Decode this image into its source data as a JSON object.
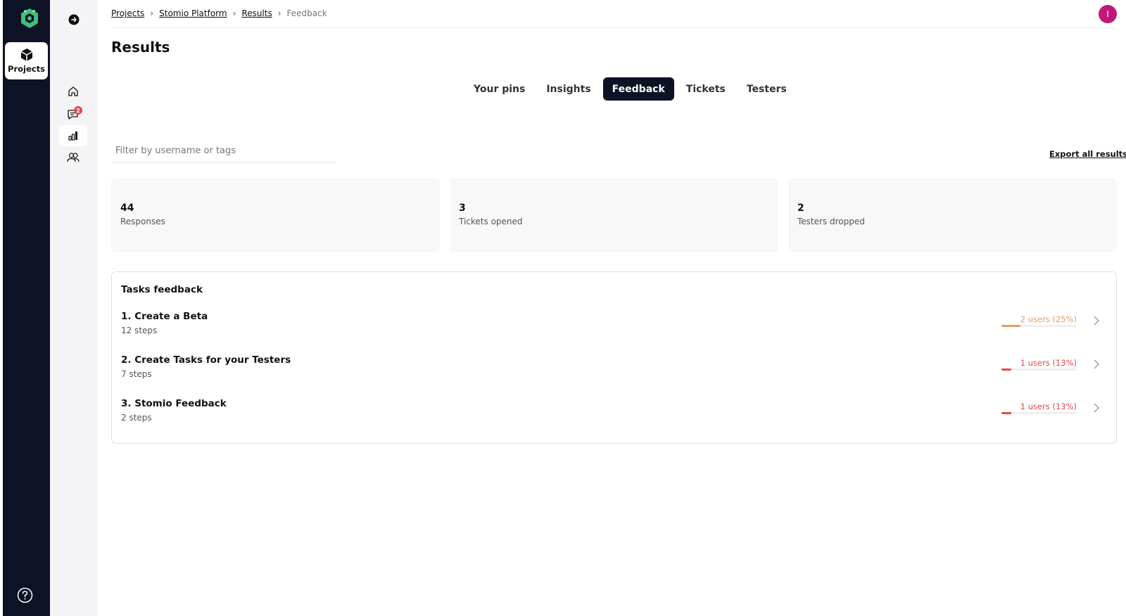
{
  "rail": {
    "projects_label": "Projects",
    "logo_icon": "stomio-logo-icon",
    "help_icon": "help-icon"
  },
  "subnav": {
    "items": [
      {
        "icon": "home-icon"
      },
      {
        "icon": "chat-icon",
        "badge": "2"
      },
      {
        "icon": "bar-chart-icon",
        "active": true
      },
      {
        "icon": "users-icon"
      }
    ]
  },
  "breadcrumb": {
    "items": [
      "Projects",
      "Stomio Platform",
      "Results"
    ],
    "current": "Feedback"
  },
  "user": {
    "initial": "I",
    "color": "#c2187a"
  },
  "page": {
    "title": "Results"
  },
  "tabs": [
    {
      "label": "Your pins",
      "active": false
    },
    {
      "label": "Insights",
      "active": false
    },
    {
      "label": "Feedback",
      "active": true
    },
    {
      "label": "Tickets",
      "active": false
    },
    {
      "label": "Testers",
      "active": false
    }
  ],
  "filter": {
    "placeholder": "Filter by username or tags",
    "value": ""
  },
  "export_label": "Export all results",
  "stats": [
    {
      "value": "44",
      "label": "Responses"
    },
    {
      "value": "3",
      "label": "Tickets opened"
    },
    {
      "value": "2",
      "label": "Testers dropped"
    }
  ],
  "tasks": {
    "title": "Tasks feedback",
    "items": [
      {
        "name": "1. Create a Beta",
        "steps": "12 steps",
        "users": "2 users (25%)",
        "percent": 25,
        "color": "#e0a060"
      },
      {
        "name": "2. Create Tasks for your Testers",
        "steps": "7 steps",
        "users": "1 users (13%)",
        "percent": 13,
        "color": "#e5484d"
      },
      {
        "name": "3. Stomio Feedback",
        "steps": "2 steps",
        "users": "1 users (13%)",
        "percent": 13,
        "color": "#e5484d"
      }
    ]
  }
}
